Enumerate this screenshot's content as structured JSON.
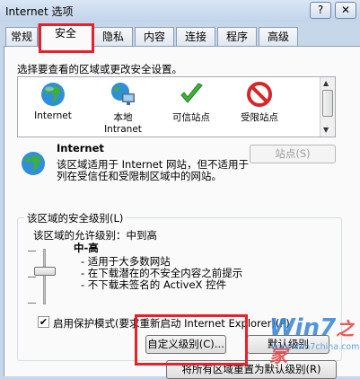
{
  "window": {
    "title": "Internet 选项",
    "help_label": "?",
    "close_label": "✕"
  },
  "tabs": [
    {
      "label": "常规"
    },
    {
      "label": "安全"
    },
    {
      "label": "隐私"
    },
    {
      "label": "内容"
    },
    {
      "label": "连接"
    },
    {
      "label": "程序"
    },
    {
      "label": "高级"
    }
  ],
  "instruction": "选择要查看的区域或更改安全设置。",
  "zones": [
    {
      "label": "Internet",
      "label2": "",
      "icon": "globe-icon"
    },
    {
      "label": "本地",
      "label2": "Intranet",
      "icon": "local-intranet-icon"
    },
    {
      "label": "可信站点",
      "label2": "",
      "icon": "checkmark-icon"
    },
    {
      "label": "受限站点",
      "label2": "",
      "icon": "no-entry-icon"
    }
  ],
  "selected_zone": {
    "name": "Internet",
    "description": "该区域适用于 Internet 网站，但不适用于列在受信任和受限制区域中的网站。",
    "sites_button": "站点(S)"
  },
  "security_level": {
    "group_title": "该区域的安全级别(L)",
    "allowed_levels": "该区域的允许级别：中到高",
    "level_name": "中-高",
    "bullets": [
      "- 适用于大多数网站",
      "- 在下载潜在的不安全内容之前提示",
      "- 不下载未签名的 ActiveX 控件"
    ],
    "slider_level": 0.6,
    "protected_mode_checked": true,
    "protected_mode_label": "启用保护模式(要求重新启动 Internet Explorer)(P)",
    "custom_level_button": "自定义级别(C)...",
    "default_level_button": "默认级别"
  },
  "reset_all_button": "将所有区域重置为默认级别(R)",
  "watermark": {
    "logo": "Win7",
    "logo_suffix": "之家",
    "url": "www.Win7china.com"
  },
  "colors": {
    "highlight_box": "#e8202a",
    "dialog_bg": "#fafafa",
    "frame": "#c7d7ea"
  }
}
